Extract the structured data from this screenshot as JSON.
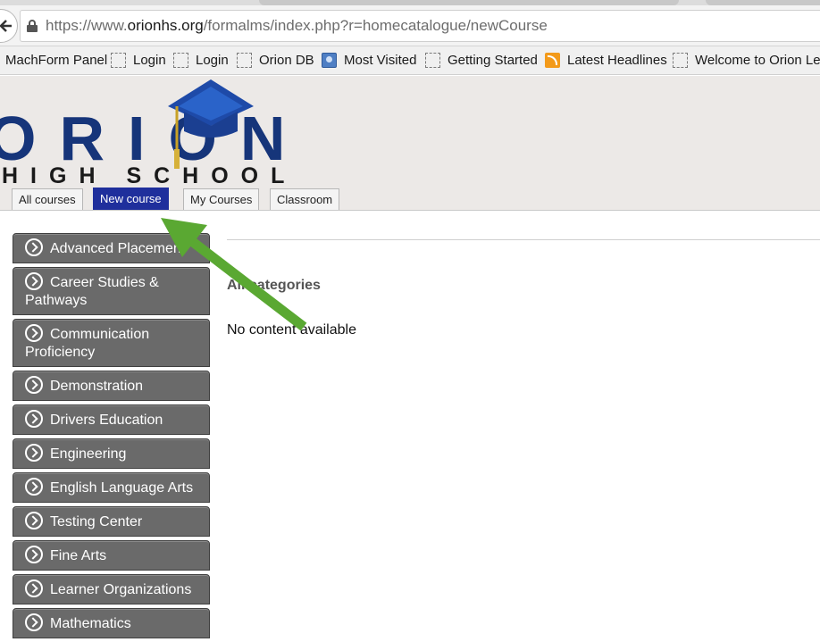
{
  "browser": {
    "url_prefix": "https://www.",
    "url_host": "orionhs.org",
    "url_path": "/formalms/index.php?r=homecatalogue/newCourse",
    "bookmarks": [
      {
        "label": "MachForm Panel",
        "icon": "none"
      },
      {
        "label": "Login",
        "icon": "dashed-page-icon"
      },
      {
        "label": "Login",
        "icon": "dashed-page-icon"
      },
      {
        "label": "Orion DB",
        "icon": "dashed-page-icon"
      },
      {
        "label": "Most Visited",
        "icon": "globe-icon"
      },
      {
        "label": "Getting Started",
        "icon": "dashed-page-icon"
      },
      {
        "label": "Latest Headlines",
        "icon": "rss-icon"
      },
      {
        "label": "Welcome to Orion Le",
        "icon": "dashed-page-icon"
      }
    ]
  },
  "header": {
    "logo_main": "ORION",
    "logo_sub": "HIGH SCHOOL",
    "colors": {
      "logo_blue": "#16357a",
      "active_tab": "#1f2f9c",
      "arrow": "#5aa832"
    }
  },
  "tabs": [
    {
      "label": "All courses",
      "active": false
    },
    {
      "label": "New course",
      "active": true
    },
    {
      "label": "My Courses",
      "active": false
    },
    {
      "label": "Classroom",
      "active": false
    }
  ],
  "sidebar": {
    "categories": [
      {
        "label": "Advanced Placement"
      },
      {
        "label": "Career Studies & Pathways"
      },
      {
        "label": "Communication Proficiency"
      },
      {
        "label": "Demonstration"
      },
      {
        "label": "Drivers Education"
      },
      {
        "label": "Engineering"
      },
      {
        "label": "English Language Arts"
      },
      {
        "label": "Testing Center"
      },
      {
        "label": "Fine Arts"
      },
      {
        "label": "Learner Organizations"
      },
      {
        "label": "Mathematics"
      }
    ]
  },
  "main": {
    "heading": "All categories",
    "empty_message": "No content available"
  }
}
